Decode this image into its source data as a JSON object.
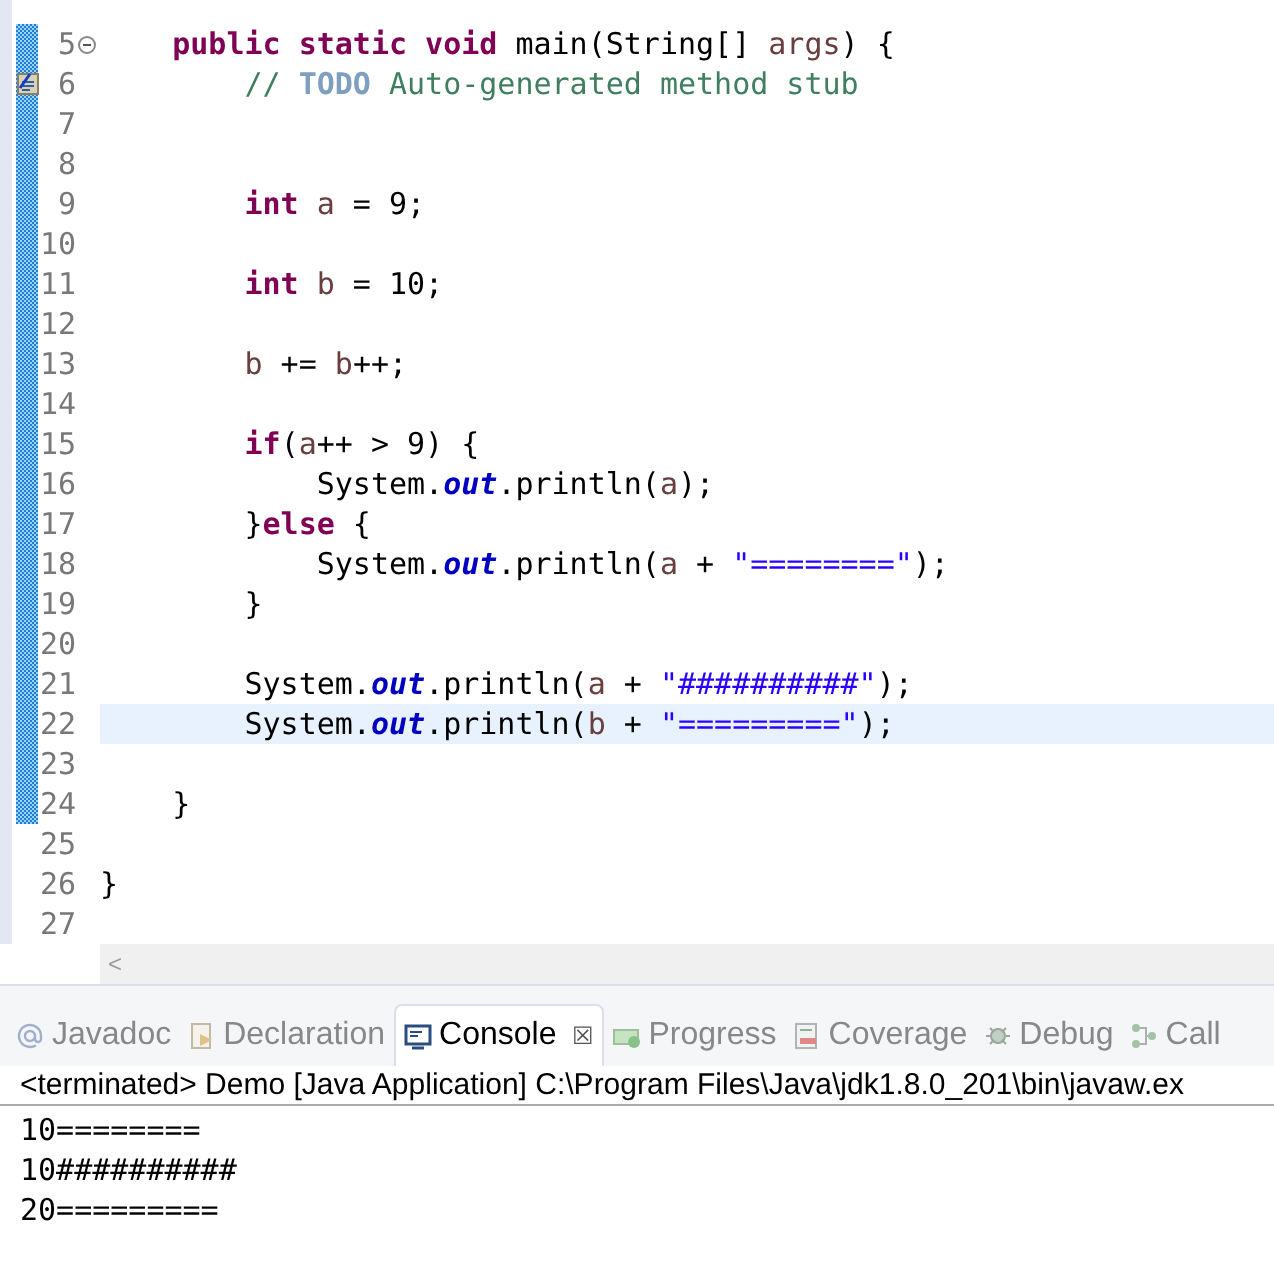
{
  "editor": {
    "lines": [
      {
        "number": "5",
        "current": false,
        "fold": true,
        "task": false,
        "changed": true,
        "tokens": [
          {
            "kind": "keyword",
            "text": "    public"
          },
          {
            "kind": "keyword",
            "text": " static"
          },
          {
            "kind": "keyword",
            "text": " void"
          },
          {
            "kind": "plain",
            "text": " main(String[]"
          },
          {
            "kind": "variable",
            "text": " args"
          },
          {
            "kind": "plain",
            "text": ") {"
          }
        ]
      },
      {
        "number": "6",
        "current": false,
        "fold": false,
        "task": true,
        "changed": true,
        "tokens": [
          {
            "kind": "comment",
            "text": "        // "
          },
          {
            "kind": "todo",
            "text": "TODO"
          },
          {
            "kind": "comment",
            "text": " Auto-generated method stub"
          }
        ]
      },
      {
        "number": "7",
        "current": false,
        "fold": false,
        "task": false,
        "changed": true
      },
      {
        "number": "8",
        "current": false,
        "fold": false,
        "task": false,
        "changed": true
      },
      {
        "number": "9",
        "current": false,
        "fold": false,
        "task": false,
        "changed": true,
        "tokens": [
          {
            "kind": "keyword",
            "text": "        int"
          },
          {
            "kind": "variable",
            "text": " a"
          },
          {
            "kind": "plain",
            "text": " = 9;"
          }
        ]
      },
      {
        "number": "10",
        "current": false,
        "fold": false,
        "task": false,
        "changed": true
      },
      {
        "number": "11",
        "current": false,
        "fold": false,
        "task": false,
        "changed": true,
        "tokens": [
          {
            "kind": "keyword",
            "text": "        int"
          },
          {
            "kind": "variable",
            "text": " b"
          },
          {
            "kind": "plain",
            "text": " = 10;"
          }
        ]
      },
      {
        "number": "12",
        "current": false,
        "fold": false,
        "task": false,
        "changed": true
      },
      {
        "number": "13",
        "current": false,
        "fold": false,
        "task": false,
        "changed": true,
        "tokens": [
          {
            "kind": "variable",
            "text": "        b"
          },
          {
            "kind": "plain",
            "text": " +="
          },
          {
            "kind": "variable",
            "text": " b"
          },
          {
            "kind": "plain",
            "text": "++;"
          }
        ]
      },
      {
        "number": "14",
        "current": false,
        "fold": false,
        "task": false,
        "changed": true
      },
      {
        "number": "15",
        "current": false,
        "fold": false,
        "task": false,
        "changed": true,
        "tokens": [
          {
            "kind": "keyword",
            "text": "        if"
          },
          {
            "kind": "plain",
            "text": "("
          },
          {
            "kind": "variable",
            "text": "a"
          },
          {
            "kind": "plain",
            "text": "++ > 9) {"
          }
        ]
      },
      {
        "number": "16",
        "current": false,
        "fold": false,
        "task": false,
        "changed": true,
        "tokens": [
          {
            "kind": "plain",
            "text": "            System."
          },
          {
            "kind": "field",
            "text": "out"
          },
          {
            "kind": "plain",
            "text": ".println("
          },
          {
            "kind": "variable",
            "text": "a"
          },
          {
            "kind": "plain",
            "text": ");"
          }
        ]
      },
      {
        "number": "17",
        "current": false,
        "fold": false,
        "task": false,
        "changed": true,
        "tokens": [
          {
            "kind": "plain",
            "text": "        }"
          },
          {
            "kind": "keyword",
            "text": "else"
          },
          {
            "kind": "plain",
            "text": " {"
          }
        ]
      },
      {
        "number": "18",
        "current": false,
        "fold": false,
        "task": false,
        "changed": true,
        "tokens": [
          {
            "kind": "plain",
            "text": "            System."
          },
          {
            "kind": "field",
            "text": "out"
          },
          {
            "kind": "plain",
            "text": ".println("
          },
          {
            "kind": "variable",
            "text": "a"
          },
          {
            "kind": "plain",
            "text": " + "
          },
          {
            "kind": "string",
            "text": "\"========\""
          },
          {
            "kind": "plain",
            "text": ");"
          }
        ]
      },
      {
        "number": "19",
        "current": false,
        "fold": false,
        "task": false,
        "changed": true,
        "tokens": [
          {
            "kind": "plain",
            "text": "        }"
          }
        ]
      },
      {
        "number": "20",
        "current": false,
        "fold": false,
        "task": false,
        "changed": true
      },
      {
        "number": "21",
        "current": false,
        "fold": false,
        "task": false,
        "changed": true,
        "tokens": [
          {
            "kind": "plain",
            "text": "        System."
          },
          {
            "kind": "field",
            "text": "out"
          },
          {
            "kind": "plain",
            "text": ".println("
          },
          {
            "kind": "variable",
            "text": "a"
          },
          {
            "kind": "plain",
            "text": " + "
          },
          {
            "kind": "string",
            "text": "\"##########\""
          },
          {
            "kind": "plain",
            "text": ");"
          }
        ]
      },
      {
        "number": "22",
        "current": true,
        "fold": false,
        "task": false,
        "changed": true,
        "tokens": [
          {
            "kind": "plain",
            "text": "        System."
          },
          {
            "kind": "field",
            "text": "out"
          },
          {
            "kind": "plain",
            "text": ".println("
          },
          {
            "kind": "variable",
            "text": "b"
          },
          {
            "kind": "plain",
            "text": " + "
          },
          {
            "kind": "string",
            "text": "\"=========\""
          },
          {
            "kind": "plain",
            "text": ");"
          }
        ]
      },
      {
        "number": "23",
        "current": false,
        "fold": false,
        "task": false,
        "changed": true
      },
      {
        "number": "24",
        "current": false,
        "fold": false,
        "task": false,
        "changed": true,
        "tokens": [
          {
            "kind": "plain",
            "text": "    }"
          }
        ]
      },
      {
        "number": "25",
        "current": false,
        "fold": false,
        "task": false,
        "changed": false
      },
      {
        "number": "26",
        "current": false,
        "fold": false,
        "task": false,
        "changed": false,
        "tokens": [
          {
            "kind": "plain",
            "text": "}"
          }
        ]
      },
      {
        "number": "27",
        "current": false,
        "fold": false,
        "task": false,
        "changed": false
      }
    ],
    "scroll_left": "<"
  },
  "views": {
    "tabs": [
      {
        "kind": "javadoc",
        "label": "Javadoc",
        "selected": false
      },
      {
        "kind": "declaration",
        "label": "Declaration",
        "selected": false
      },
      {
        "kind": "console",
        "label": "Console",
        "selected": true,
        "close": "☒"
      },
      {
        "kind": "progress",
        "label": "Progress",
        "selected": false
      },
      {
        "kind": "coverage",
        "label": "Coverage",
        "selected": false
      },
      {
        "kind": "debug",
        "label": "Debug",
        "selected": false
      },
      {
        "kind": "call",
        "label": "Call",
        "selected": false
      }
    ]
  },
  "console": {
    "header": "<terminated> Demo [Java Application] C:\\Program Files\\Java\\jdk1.8.0_201\\bin\\javaw.ex",
    "output": [
      "10========",
      "10##########",
      "20========="
    ]
  }
}
